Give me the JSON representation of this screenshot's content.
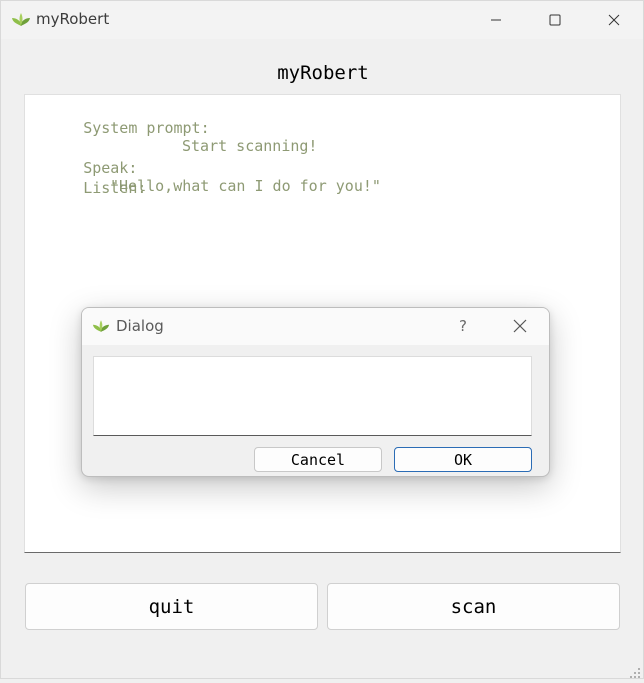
{
  "window": {
    "title": "myRobert",
    "controls": [
      "minimize-icon",
      "maximize-icon",
      "close-icon"
    ]
  },
  "main": {
    "heading": "myRobert",
    "log": [
      {
        "label": "System prompt:",
        "value": "Start scanning!"
      },
      {
        "label": "Speak:",
        "value": "\"Hello,what can I do for you!\""
      },
      {
        "label": "Listen:",
        "value": ""
      }
    ],
    "buttons": {
      "quit": "quit",
      "scan": "scan"
    }
  },
  "dialog": {
    "title": "Dialog",
    "help": "?",
    "input_value": "",
    "cancel_label": "Cancel",
    "ok_label": "OK"
  },
  "colors": {
    "log_text": "#8e9a74",
    "accent_border": "#2b6cb5",
    "icon_green": "#7fae3e"
  }
}
